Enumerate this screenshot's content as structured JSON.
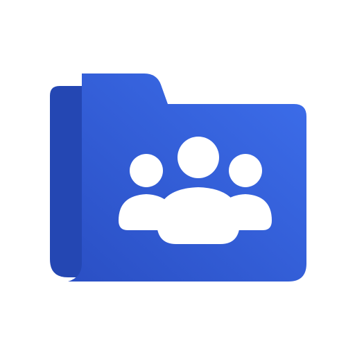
{
  "icon": {
    "name": "shared-folder-icon",
    "depicts": [
      "folder-icon",
      "group-icon"
    ],
    "colors": {
      "background": "#ffffff",
      "folder_back": "#2447B3",
      "folder_front_start": "#2A4FC4",
      "folder_front_end": "#3D6EEB",
      "figures": "#ffffff",
      "figure_edge_shadow": "#1E3A9A"
    }
  }
}
